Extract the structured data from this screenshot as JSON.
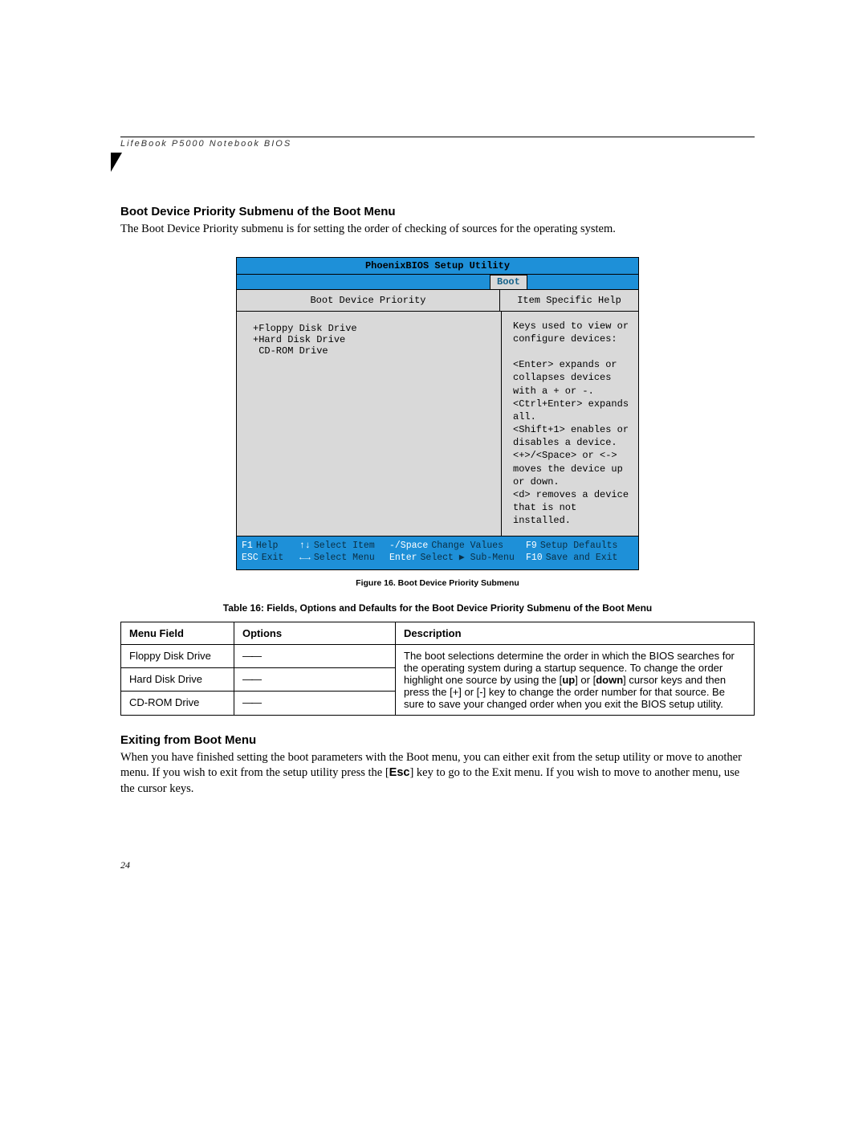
{
  "runningHead": "LifeBook P5000 Notebook BIOS",
  "h2a": "Boot Device Priority Submenu of the Boot Menu",
  "introPara": "The Boot Device Priority submenu is for setting the order of checking of sources for the operating system.",
  "bios": {
    "title": "PhoenixBIOS Setup Utility",
    "activeTab": "Boot",
    "leftHeader": "Boot Device Priority",
    "rightHeader": "Item Specific Help",
    "devices": [
      "+Floppy Disk Drive",
      "+Hard Disk Drive",
      " CD-ROM Drive"
    ],
    "help": "Keys used to view or configure devices:\n\n<Enter> expands or collapses devices with a + or -.\n<Ctrl+Enter> expands all.\n<Shift+1> enables or disables a device.\n<+>/<Space> or <-> moves the device up or down.\n<d> removes a device that is not installed.",
    "footer": {
      "r1": {
        "k1": "F1",
        "d1": "Help",
        "k2": "↑↓",
        "d2": "Select Item",
        "k3": "-/Space",
        "d3": "Change Values",
        "k4": "F9",
        "d4": "Setup Defaults"
      },
      "r2": {
        "k1": "ESC",
        "d1": "Exit",
        "k2": "←→",
        "d2": "Select Menu",
        "k3": "Enter",
        "d3": "Select ▶ Sub-Menu",
        "k4": "F10",
        "d4": "Save and Exit"
      }
    }
  },
  "figCaption": "Figure 16.  Boot Device Priority Submenu",
  "tableCaption": "Table 16: Fields, Options and Defaults for the Boot Device Priority Submenu of the Boot Menu",
  "table": {
    "headers": {
      "a": "Menu Field",
      "b": "Options",
      "c": "Description"
    },
    "rows": [
      {
        "field": "Floppy Disk Drive",
        "options": "——"
      },
      {
        "field": "Hard Disk Drive",
        "options": "——"
      },
      {
        "field": "CD-ROM Drive",
        "options": "——"
      }
    ],
    "descA": "The boot selections determine the order in which the BIOS searches for the operating system during a startup sequence. To change the order highlight one source by using the [",
    "descUp": "up",
    "descB": "] or [",
    "descDown": "down",
    "descC": "] cursor keys and then press the [+] or [-] key to change the order number for that source. Be sure to save your changed order when you exit the BIOS setup utility."
  },
  "h2b": "Exiting from Boot Menu",
  "exitParaA": "When you have finished setting the boot parameters with the Boot menu, you can either exit from the setup utility or move to another menu. If you wish to exit from the setup utility press the [",
  "exitKey": "Esc",
  "exitParaB": "] key to go to the Exit menu. If you wish to move to another menu, use the cursor keys.",
  "pageNum": "24"
}
